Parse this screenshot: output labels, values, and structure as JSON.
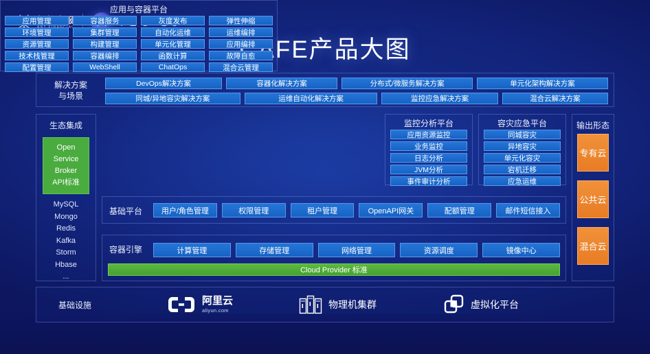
{
  "header": {
    "ant_logo_cn": "蚂蚁金服",
    "ant_logo_en": "ANT FINANCIAL",
    "atec_letters": "TEC 18",
    "atec_ball_letter": "A"
  },
  "title": "CAFE产品大图",
  "solutions": {
    "label": "解决方案\n与场景",
    "label_line1": "解决方案",
    "label_line2": "与场景",
    "row1": [
      "DevOps解决方案",
      "容器化解决方案",
      "分布式/微服务解决方案",
      "单元化架构解决方案"
    ],
    "row2": [
      "同城/异地容灾解决方案",
      "运维自动化解决方案",
      "监控应急解决方案",
      "混合云解决方案"
    ]
  },
  "ecosystem": {
    "title": "生态集成",
    "standard": [
      "Open",
      "Service",
      "Broker",
      "API标准"
    ],
    "items": [
      "MySQL",
      "Mongo",
      "Redis",
      "Kafka",
      "Storm",
      "Hbase",
      "..."
    ]
  },
  "app_platform": {
    "title": "应用与容器平台",
    "tiles": [
      "应用管理",
      "容器服务",
      "灰度发布",
      "弹性伸缩",
      "环境管理",
      "集群管理",
      "自动化运维",
      "运维编排",
      "资源管理",
      "构建管理",
      "单元化管理",
      "应用编排",
      "技术栈管理",
      "容器编排",
      "函数计算",
      "故障自愈",
      "配置管理",
      "WebShell",
      "ChatOps",
      "混合云管理"
    ]
  },
  "monitoring": {
    "title": "监控分析平台",
    "items": [
      "应用资源监控",
      "业务监控",
      "日志分析",
      "JVM分析",
      "事件审计分析"
    ]
  },
  "disaster_recovery": {
    "title": "容灾应急平台",
    "items": [
      "同城容灾",
      "异地容灾",
      "单元化容灾",
      "宕机迁移",
      "应急运维"
    ]
  },
  "base_platform": {
    "label": "基础平台",
    "items": [
      "用户/角色管理",
      "权限管理",
      "租户管理",
      "OpenAPI网关",
      "配额管理",
      "邮件短信接入"
    ]
  },
  "container_engine": {
    "label": "容器引擎",
    "items": [
      "计算管理",
      "存储管理",
      "网络管理",
      "资源调度",
      "镜像中心"
    ],
    "cloud_provider_bar": "Cloud Provider 标准"
  },
  "output": {
    "title": "输出形态",
    "items": [
      "专有云",
      "公共云",
      "混合云"
    ]
  },
  "infrastructure": {
    "label": "基础设施",
    "items": [
      {
        "icon": "aliyun-icon",
        "cn": "阿里云",
        "en": "aliyun.com"
      },
      {
        "icon": "server-rack-icon",
        "label": "物理机集群"
      },
      {
        "icon": "virtualization-icon",
        "label": "虚拟化平台"
      }
    ]
  },
  "colors": {
    "background": "#0d1760",
    "tile_blue": "#1b6fd0",
    "accent_green": "#4aab3e",
    "accent_orange": "#e87c24"
  }
}
